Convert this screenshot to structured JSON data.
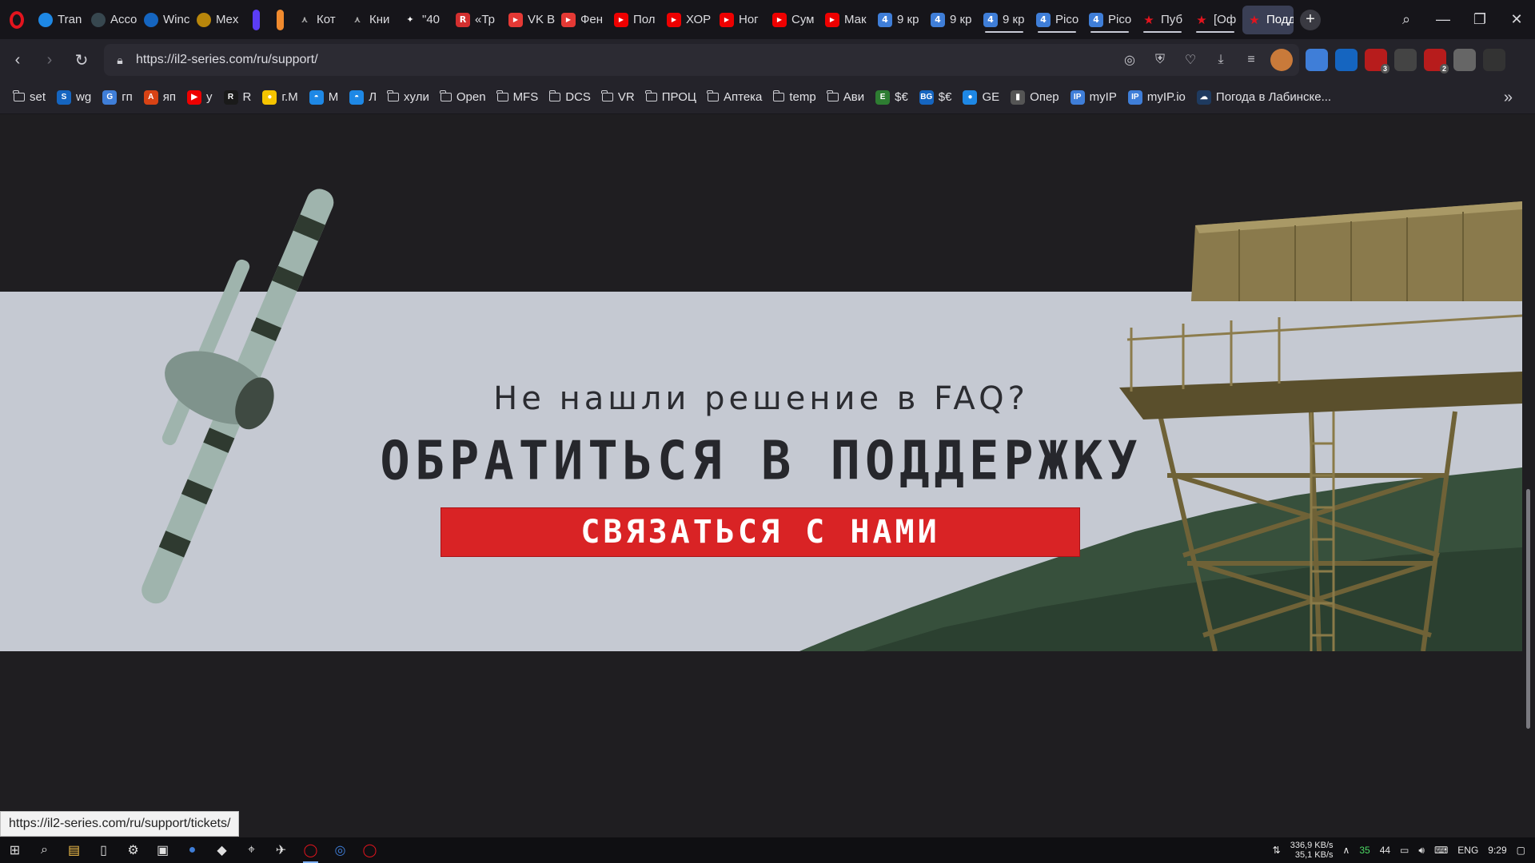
{
  "colors": {
    "accent_red": "#d92325",
    "banner_bg": "#c5c9d2",
    "page_bg": "#1f1e21",
    "active_tab": "#3a3f55"
  },
  "tabs": [
    {
      "label": "Tran",
      "icon": "wifi-icon",
      "color": "#1e88e5",
      "w": "w1"
    },
    {
      "label": "Acco",
      "icon": "vpn-icon",
      "color": "#37474f",
      "w": "w1"
    },
    {
      "label": "Winc",
      "icon": "steelseries-icon",
      "color": "#1565c0",
      "w": "w1"
    },
    {
      "label": "Mex",
      "icon": "emblem-icon",
      "color": "#b8860b",
      "w": "w1"
    },
    {
      "label": "",
      "icon": "pill-icon",
      "color": "#5b3df5",
      "w": "w2"
    },
    {
      "label": "",
      "icon": "pill-icon",
      "color": "#f08a2e",
      "w": "w2"
    },
    {
      "label": "Кот",
      "icon": "bird-icon",
      "color": "#444",
      "w": "w1"
    },
    {
      "label": "Кни",
      "icon": "bird-icon",
      "color": "#444",
      "w": "w1"
    },
    {
      "label": "\"40",
      "icon": "star-icon",
      "color": "#333",
      "w": "w1"
    },
    {
      "label": "«Тр",
      "icon": "r-icon",
      "color": "#d32f2f",
      "w": "w1"
    },
    {
      "label": "VK В",
      "icon": "play-icon",
      "color": "#e53935",
      "w": "w1"
    },
    {
      "label": "Фен",
      "icon": "play-icon",
      "color": "#e53935",
      "w": "w1"
    },
    {
      "label": "Пол",
      "icon": "youtube-icon",
      "color": "#e00",
      "w": "w1"
    },
    {
      "label": "ХОР",
      "icon": "youtube-icon",
      "color": "#e00",
      "w": "w1"
    },
    {
      "label": "Ног",
      "icon": "youtube-icon",
      "color": "#e00",
      "w": "w1"
    },
    {
      "label": "Сум",
      "icon": "youtube-icon",
      "color": "#e00",
      "w": "w1"
    },
    {
      "label": "Мак",
      "icon": "youtube-icon",
      "color": "#e00",
      "w": "w1"
    },
    {
      "label": "9 кр",
      "icon": "4pda-icon",
      "color": "#3f7ed8",
      "w": "w1"
    },
    {
      "label": "9 кр",
      "icon": "4pda-icon",
      "color": "#3f7ed8",
      "w": "w1"
    },
    {
      "label": "9 кр",
      "icon": "4pda-icon",
      "color": "#3f7ed8",
      "w": "w1",
      "underline": true
    },
    {
      "label": "Pico",
      "icon": "4pda-icon",
      "color": "#3f7ed8",
      "w": "w1",
      "underline": true
    },
    {
      "label": "Pico",
      "icon": "4pda-icon",
      "color": "#3f7ed8",
      "w": "w1",
      "underline": true
    },
    {
      "label": "Пуб",
      "icon": "star-red-icon",
      "color": "#16151a",
      "w": "w1",
      "underline": true
    },
    {
      "label": "[Оф",
      "icon": "star-red-icon",
      "color": "#16151a",
      "w": "w1",
      "underline": true
    },
    {
      "label": "Поддерж",
      "icon": "star-red-icon",
      "color": "#3a3f55",
      "w": "w1",
      "active": true
    }
  ],
  "address": {
    "url": "https://il2-series.com/ru/support/"
  },
  "bookmarks": [
    {
      "label": "set",
      "type": "folder"
    },
    {
      "label": "wg",
      "type": "site",
      "color": "#1565c0",
      "glyph": "S"
    },
    {
      "label": "гп",
      "type": "site",
      "color": "#3f7ed8",
      "glyph": "G"
    },
    {
      "label": "яп",
      "type": "site",
      "color": "#d84315",
      "glyph": "A"
    },
    {
      "label": "у",
      "type": "site",
      "color": "#e00",
      "glyph": "▶"
    },
    {
      "label": "R",
      "type": "site",
      "color": "#1a1a1a",
      "glyph": "R"
    },
    {
      "label": "г.М",
      "type": "site",
      "color": "#f5c400",
      "glyph": "●"
    },
    {
      "label": "М",
      "type": "site",
      "color": "#1e88e5",
      "glyph": "◓"
    },
    {
      "label": "Л",
      "type": "site",
      "color": "#1e88e5",
      "glyph": "◓"
    },
    {
      "label": "хули",
      "type": "folder"
    },
    {
      "label": "Open",
      "type": "folder"
    },
    {
      "label": "MFS",
      "type": "folder"
    },
    {
      "label": "DCS",
      "type": "folder"
    },
    {
      "label": "VR",
      "type": "folder"
    },
    {
      "label": "ПРОЦ",
      "type": "folder"
    },
    {
      "label": "Аптека",
      "type": "folder"
    },
    {
      "label": "temp",
      "type": "folder"
    },
    {
      "label": "Ави",
      "type": "folder"
    },
    {
      "label": "$€",
      "type": "site",
      "color": "#2e7d32",
      "glyph": "E"
    },
    {
      "label": "$€",
      "type": "site",
      "color": "#1565c0",
      "glyph": "BG"
    },
    {
      "label": "GE",
      "type": "site",
      "color": "#1e88e5",
      "glyph": "●"
    },
    {
      "label": "Опер",
      "type": "site",
      "color": "#555",
      "glyph": "▮"
    },
    {
      "label": "myIP",
      "type": "site",
      "color": "#3f7ed8",
      "glyph": "IP"
    },
    {
      "label": "myIP.io",
      "type": "site",
      "color": "#3f7ed8",
      "glyph": "IP"
    },
    {
      "label": "Погода в Лабинске...",
      "type": "site",
      "color": "#1e3a5f",
      "glyph": "☁"
    }
  ],
  "page": {
    "subheading": "Не нашли решение в FAQ?",
    "heading": "ОБРАТИТЬСЯ В ПОДДЕРЖКУ",
    "button": "СВЯЗАТЬСЯ С НАМИ"
  },
  "status_url": "https://il2-series.com/ru/support/tickets/",
  "taskbar": {
    "net_down": "336,9 KB/s",
    "net_up": "35,1 KB/s",
    "tray_num1": "35",
    "tray_num2": "44",
    "language": "ENG",
    "time": "9:29"
  },
  "extensions": [
    {
      "icon": "translate-icon",
      "color": "#3f7ed8",
      "badge": ""
    },
    {
      "icon": "steelseries-icon",
      "color": "#1565c0",
      "badge": ""
    },
    {
      "icon": "ublock-icon",
      "color": "#b71c1c",
      "badge": "3"
    },
    {
      "icon": "vr-icon",
      "color": "#444",
      "badge": ""
    },
    {
      "icon": "ublock-icon",
      "color": "#b71c1c",
      "badge": "2"
    },
    {
      "icon": "globe-icon",
      "color": "#666",
      "badge": ""
    },
    {
      "icon": "cube-icon",
      "color": "#333",
      "badge": ""
    }
  ]
}
